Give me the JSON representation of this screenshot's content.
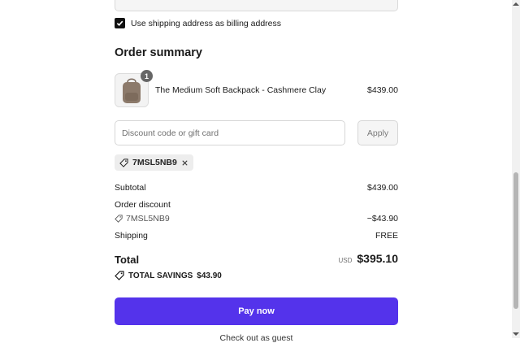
{
  "billing": {
    "same_as_shipping_label": "Use shipping address as billing address",
    "checked": true
  },
  "summary": {
    "title": "Order summary",
    "item": {
      "name": "The Medium Soft Backpack - Cashmere Clay",
      "price": "$439.00",
      "quantity": "1",
      "icon": "backpack-image"
    },
    "discount": {
      "placeholder": "Discount code or gift card",
      "apply_label": "Apply",
      "applied_code": "7MSL5NB9"
    },
    "subtotal_label": "Subtotal",
    "subtotal_value": "$439.00",
    "order_discount_label": "Order discount",
    "order_discount_code": "7MSL5NB9",
    "order_discount_value": "−$43.90",
    "shipping_label": "Shipping",
    "shipping_value": "FREE",
    "total_label": "Total",
    "total_currency": "USD",
    "total_value": "$395.10",
    "savings_label": "TOTAL SAVINGS",
    "savings_value": "$43.90"
  },
  "pay_button_label": "Pay now",
  "below_button_text": "Check out as guest",
  "colors": {
    "accent": "#5433eb",
    "chip_bg": "#ededed"
  }
}
